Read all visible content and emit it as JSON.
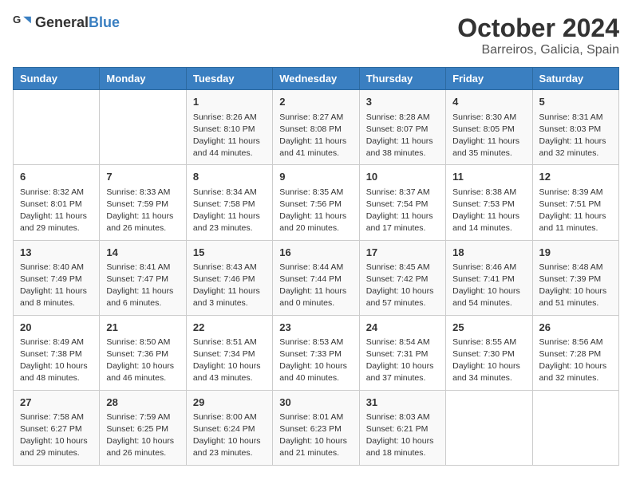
{
  "logo": {
    "text_general": "General",
    "text_blue": "Blue"
  },
  "title": {
    "month": "October 2024",
    "location": "Barreiros, Galicia, Spain"
  },
  "header": {
    "days": [
      "Sunday",
      "Monday",
      "Tuesday",
      "Wednesday",
      "Thursday",
      "Friday",
      "Saturday"
    ]
  },
  "weeks": [
    [
      {
        "day": "",
        "sunrise": "",
        "sunset": "",
        "daylight": ""
      },
      {
        "day": "",
        "sunrise": "",
        "sunset": "",
        "daylight": ""
      },
      {
        "day": "1",
        "sunrise": "Sunrise: 8:26 AM",
        "sunset": "Sunset: 8:10 PM",
        "daylight": "Daylight: 11 hours and 44 minutes."
      },
      {
        "day": "2",
        "sunrise": "Sunrise: 8:27 AM",
        "sunset": "Sunset: 8:08 PM",
        "daylight": "Daylight: 11 hours and 41 minutes."
      },
      {
        "day": "3",
        "sunrise": "Sunrise: 8:28 AM",
        "sunset": "Sunset: 8:07 PM",
        "daylight": "Daylight: 11 hours and 38 minutes."
      },
      {
        "day": "4",
        "sunrise": "Sunrise: 8:30 AM",
        "sunset": "Sunset: 8:05 PM",
        "daylight": "Daylight: 11 hours and 35 minutes."
      },
      {
        "day": "5",
        "sunrise": "Sunrise: 8:31 AM",
        "sunset": "Sunset: 8:03 PM",
        "daylight": "Daylight: 11 hours and 32 minutes."
      }
    ],
    [
      {
        "day": "6",
        "sunrise": "Sunrise: 8:32 AM",
        "sunset": "Sunset: 8:01 PM",
        "daylight": "Daylight: 11 hours and 29 minutes."
      },
      {
        "day": "7",
        "sunrise": "Sunrise: 8:33 AM",
        "sunset": "Sunset: 7:59 PM",
        "daylight": "Daylight: 11 hours and 26 minutes."
      },
      {
        "day": "8",
        "sunrise": "Sunrise: 8:34 AM",
        "sunset": "Sunset: 7:58 PM",
        "daylight": "Daylight: 11 hours and 23 minutes."
      },
      {
        "day": "9",
        "sunrise": "Sunrise: 8:35 AM",
        "sunset": "Sunset: 7:56 PM",
        "daylight": "Daylight: 11 hours and 20 minutes."
      },
      {
        "day": "10",
        "sunrise": "Sunrise: 8:37 AM",
        "sunset": "Sunset: 7:54 PM",
        "daylight": "Daylight: 11 hours and 17 minutes."
      },
      {
        "day": "11",
        "sunrise": "Sunrise: 8:38 AM",
        "sunset": "Sunset: 7:53 PM",
        "daylight": "Daylight: 11 hours and 14 minutes."
      },
      {
        "day": "12",
        "sunrise": "Sunrise: 8:39 AM",
        "sunset": "Sunset: 7:51 PM",
        "daylight": "Daylight: 11 hours and 11 minutes."
      }
    ],
    [
      {
        "day": "13",
        "sunrise": "Sunrise: 8:40 AM",
        "sunset": "Sunset: 7:49 PM",
        "daylight": "Daylight: 11 hours and 8 minutes."
      },
      {
        "day": "14",
        "sunrise": "Sunrise: 8:41 AM",
        "sunset": "Sunset: 7:47 PM",
        "daylight": "Daylight: 11 hours and 6 minutes."
      },
      {
        "day": "15",
        "sunrise": "Sunrise: 8:43 AM",
        "sunset": "Sunset: 7:46 PM",
        "daylight": "Daylight: 11 hours and 3 minutes."
      },
      {
        "day": "16",
        "sunrise": "Sunrise: 8:44 AM",
        "sunset": "Sunset: 7:44 PM",
        "daylight": "Daylight: 11 hours and 0 minutes."
      },
      {
        "day": "17",
        "sunrise": "Sunrise: 8:45 AM",
        "sunset": "Sunset: 7:42 PM",
        "daylight": "Daylight: 10 hours and 57 minutes."
      },
      {
        "day": "18",
        "sunrise": "Sunrise: 8:46 AM",
        "sunset": "Sunset: 7:41 PM",
        "daylight": "Daylight: 10 hours and 54 minutes."
      },
      {
        "day": "19",
        "sunrise": "Sunrise: 8:48 AM",
        "sunset": "Sunset: 7:39 PM",
        "daylight": "Daylight: 10 hours and 51 minutes."
      }
    ],
    [
      {
        "day": "20",
        "sunrise": "Sunrise: 8:49 AM",
        "sunset": "Sunset: 7:38 PM",
        "daylight": "Daylight: 10 hours and 48 minutes."
      },
      {
        "day": "21",
        "sunrise": "Sunrise: 8:50 AM",
        "sunset": "Sunset: 7:36 PM",
        "daylight": "Daylight: 10 hours and 46 minutes."
      },
      {
        "day": "22",
        "sunrise": "Sunrise: 8:51 AM",
        "sunset": "Sunset: 7:34 PM",
        "daylight": "Daylight: 10 hours and 43 minutes."
      },
      {
        "day": "23",
        "sunrise": "Sunrise: 8:53 AM",
        "sunset": "Sunset: 7:33 PM",
        "daylight": "Daylight: 10 hours and 40 minutes."
      },
      {
        "day": "24",
        "sunrise": "Sunrise: 8:54 AM",
        "sunset": "Sunset: 7:31 PM",
        "daylight": "Daylight: 10 hours and 37 minutes."
      },
      {
        "day": "25",
        "sunrise": "Sunrise: 8:55 AM",
        "sunset": "Sunset: 7:30 PM",
        "daylight": "Daylight: 10 hours and 34 minutes."
      },
      {
        "day": "26",
        "sunrise": "Sunrise: 8:56 AM",
        "sunset": "Sunset: 7:28 PM",
        "daylight": "Daylight: 10 hours and 32 minutes."
      }
    ],
    [
      {
        "day": "27",
        "sunrise": "Sunrise: 7:58 AM",
        "sunset": "Sunset: 6:27 PM",
        "daylight": "Daylight: 10 hours and 29 minutes."
      },
      {
        "day": "28",
        "sunrise": "Sunrise: 7:59 AM",
        "sunset": "Sunset: 6:25 PM",
        "daylight": "Daylight: 10 hours and 26 minutes."
      },
      {
        "day": "29",
        "sunrise": "Sunrise: 8:00 AM",
        "sunset": "Sunset: 6:24 PM",
        "daylight": "Daylight: 10 hours and 23 minutes."
      },
      {
        "day": "30",
        "sunrise": "Sunrise: 8:01 AM",
        "sunset": "Sunset: 6:23 PM",
        "daylight": "Daylight: 10 hours and 21 minutes."
      },
      {
        "day": "31",
        "sunrise": "Sunrise: 8:03 AM",
        "sunset": "Sunset: 6:21 PM",
        "daylight": "Daylight: 10 hours and 18 minutes."
      },
      {
        "day": "",
        "sunrise": "",
        "sunset": "",
        "daylight": ""
      },
      {
        "day": "",
        "sunrise": "",
        "sunset": "",
        "daylight": ""
      }
    ]
  ]
}
